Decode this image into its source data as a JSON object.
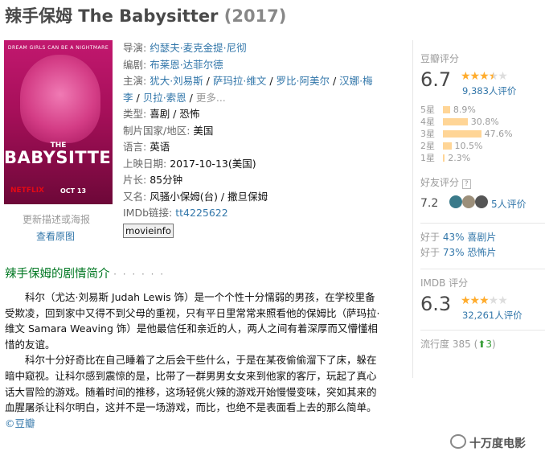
{
  "title": {
    "name": "辣手保姆 The Babysitter",
    "year": "(2017)"
  },
  "poster": {
    "tagline": "DREAM GIRLS CAN BE A NIGHTMARE",
    "title_small": "THE",
    "title_big": "BABYSITTER",
    "brand": "NETFLIX",
    "date": "OCT 13"
  },
  "poster_links": {
    "update": "更新描述或海报",
    "view_all": "查看原图"
  },
  "info": {
    "director_label": "导演:",
    "director": "约瑟夫·麦克金提·尼彻",
    "writer_label": "编剧:",
    "writer": "布莱恩·达菲尔德",
    "cast_label": "主演:",
    "cast": [
      "犹大·刘易斯",
      "萨玛拉·维文",
      "罗比·阿美尔",
      "汉娜·梅",
      "李",
      "贝拉·索恩"
    ],
    "cast_more": "更多...",
    "genre_label": "类型:",
    "genre": "喜剧 / 恐怖",
    "country_label": "制片国家/地区:",
    "country": "美国",
    "language_label": "语言:",
    "language": "英语",
    "release_label": "上映日期:",
    "release": "2017-10-13(美国)",
    "runtime_label": "片长:",
    "runtime": "85分钟",
    "aka_label": "又名:",
    "aka": "风骚小保姆(台) / 撒旦保姆",
    "imdb_label": "IMDb链接:",
    "imdb": "tt4225622",
    "info_button": "movieinfo"
  },
  "douban": {
    "heading": "豆瓣评分",
    "score": "6.7",
    "stars_full": 3,
    "stars_half": 1,
    "stars_empty": 1,
    "votes": "9,383人评价",
    "distribution": [
      {
        "label": "5星",
        "pct": "8.9%",
        "value": 8.9
      },
      {
        "label": "4星",
        "pct": "30.8%",
        "value": 30.8
      },
      {
        "label": "3星",
        "pct": "47.6%",
        "value": 47.6
      },
      {
        "label": "2星",
        "pct": "10.5%",
        "value": 10.5
      },
      {
        "label": "1星",
        "pct": "2.3%",
        "value": 2.3
      }
    ],
    "friends_heading": "好友评分",
    "friends_q": "?",
    "friends_score": "7.2",
    "friends_count": "5人评价",
    "better": [
      {
        "prefix": "好于",
        "pct": "43%",
        "genre": "喜剧片"
      },
      {
        "prefix": "好于",
        "pct": "73%",
        "genre": "恐怖片"
      }
    ],
    "better_line1": "43% 喜剧片",
    "better_line2": "73% 恐怖片"
  },
  "imdb": {
    "heading": "IMDB 评分",
    "score": "6.3",
    "stars_full": 3,
    "stars_half": 0,
    "stars_empty": 2,
    "votes": "32,261人评价"
  },
  "trend": {
    "label": "流行度",
    "value": "385",
    "change": "3"
  },
  "intro": {
    "heading": "辣手保姆的剧情简介",
    "dots": "· · · · · ·",
    "p1": "科尔（尤达·刘易斯 Judah Lewis 饰）是一个个性十分懦弱的男孩，在学校里备受欺凌，回到家中又得不到父母的重视，只有平日里常常来照看他的保姆比（萨玛拉·维文 Samara Weaving 饰）是他最信任和亲近的人，两人之间有着深厚而又懵懂相惜的友谊。",
    "p2": "科尔十分好奇比在自己睡着了之后会干些什么，于是在某夜偷偷溜下了床，躲在暗中窥视。让科尔感到震惊的是，比带了一群男男女女来到他家的客厅，玩起了真心话大冒险的游戏。随着时间的推移，这场轻佻火辣的游戏开始慢慢变味，突如其来的血腥屠杀让科尔明白，这并不是一场游戏，而比，也绝不是表面看上去的那么简单。",
    "source": "©豆瓣"
  },
  "watermark": "十万度电影",
  "colors": {
    "link": "#3377aa",
    "star": "#ffac2d",
    "bar": "#ffd596",
    "heading_green": "#007722"
  }
}
